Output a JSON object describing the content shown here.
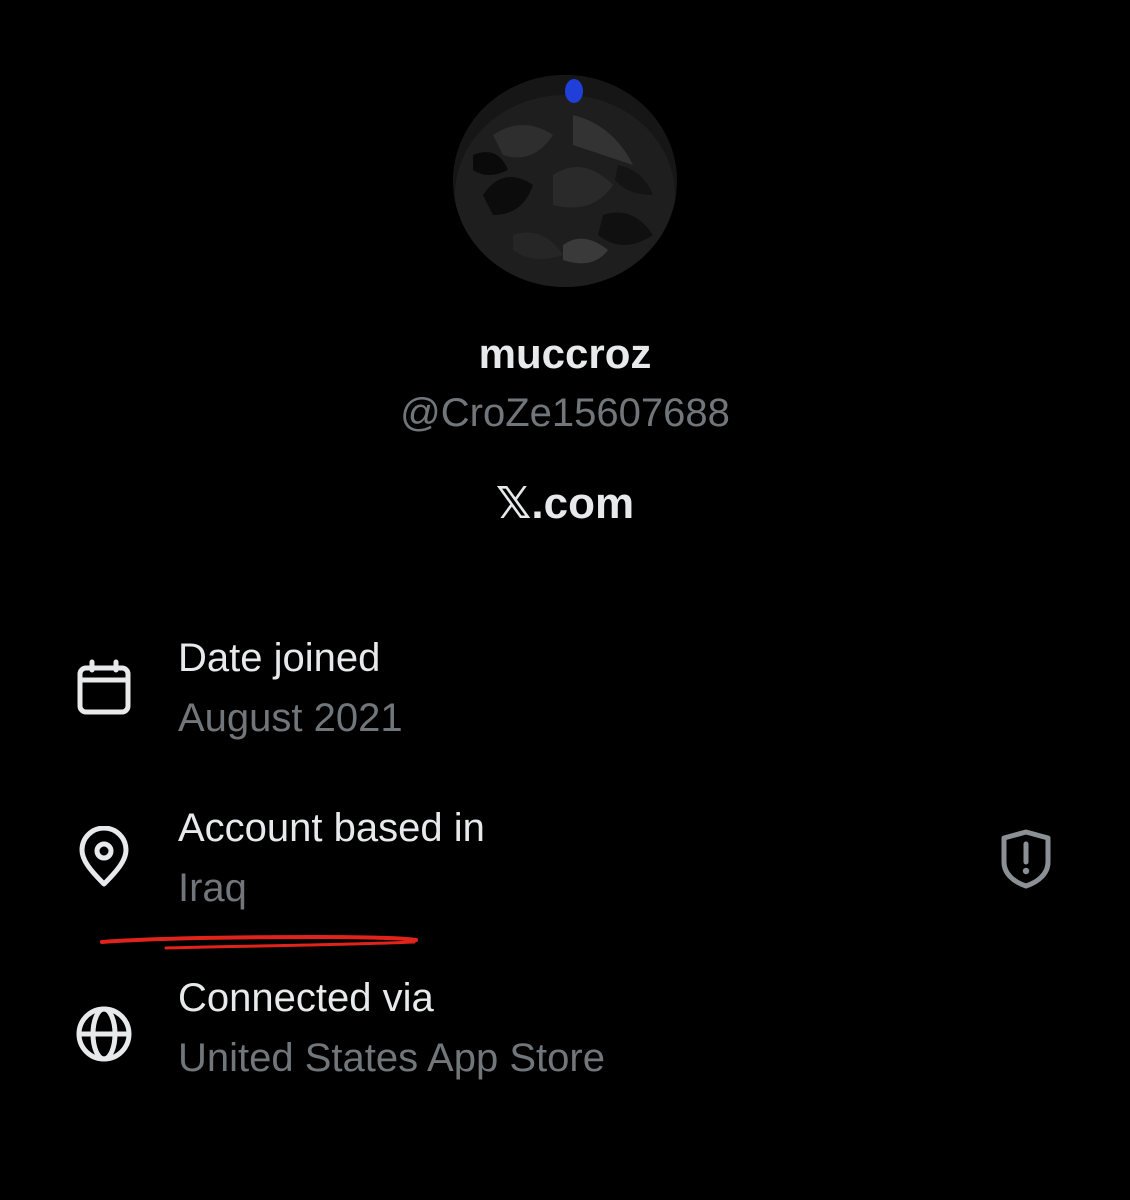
{
  "profile": {
    "display_name": "muccroz",
    "handle": "@CroZe15607688"
  },
  "brand": {
    "x_glyph": "𝕏",
    "domain": ".com"
  },
  "about": {
    "date_joined": {
      "icon": "calendar-icon",
      "label": "Date joined",
      "value": "August 2021"
    },
    "account_based": {
      "icon": "location-pin-icon",
      "label": "Account based in",
      "value": "Iraq",
      "badge_icon": "shield-exclamation-icon"
    },
    "connected_via": {
      "icon": "globe-icon",
      "label": "Connected via",
      "value": "United States App Store"
    }
  },
  "colors": {
    "background": "#000000",
    "primary_text": "#e7e9ea",
    "secondary_text": "#71767b",
    "annotation": "#e0241b"
  }
}
